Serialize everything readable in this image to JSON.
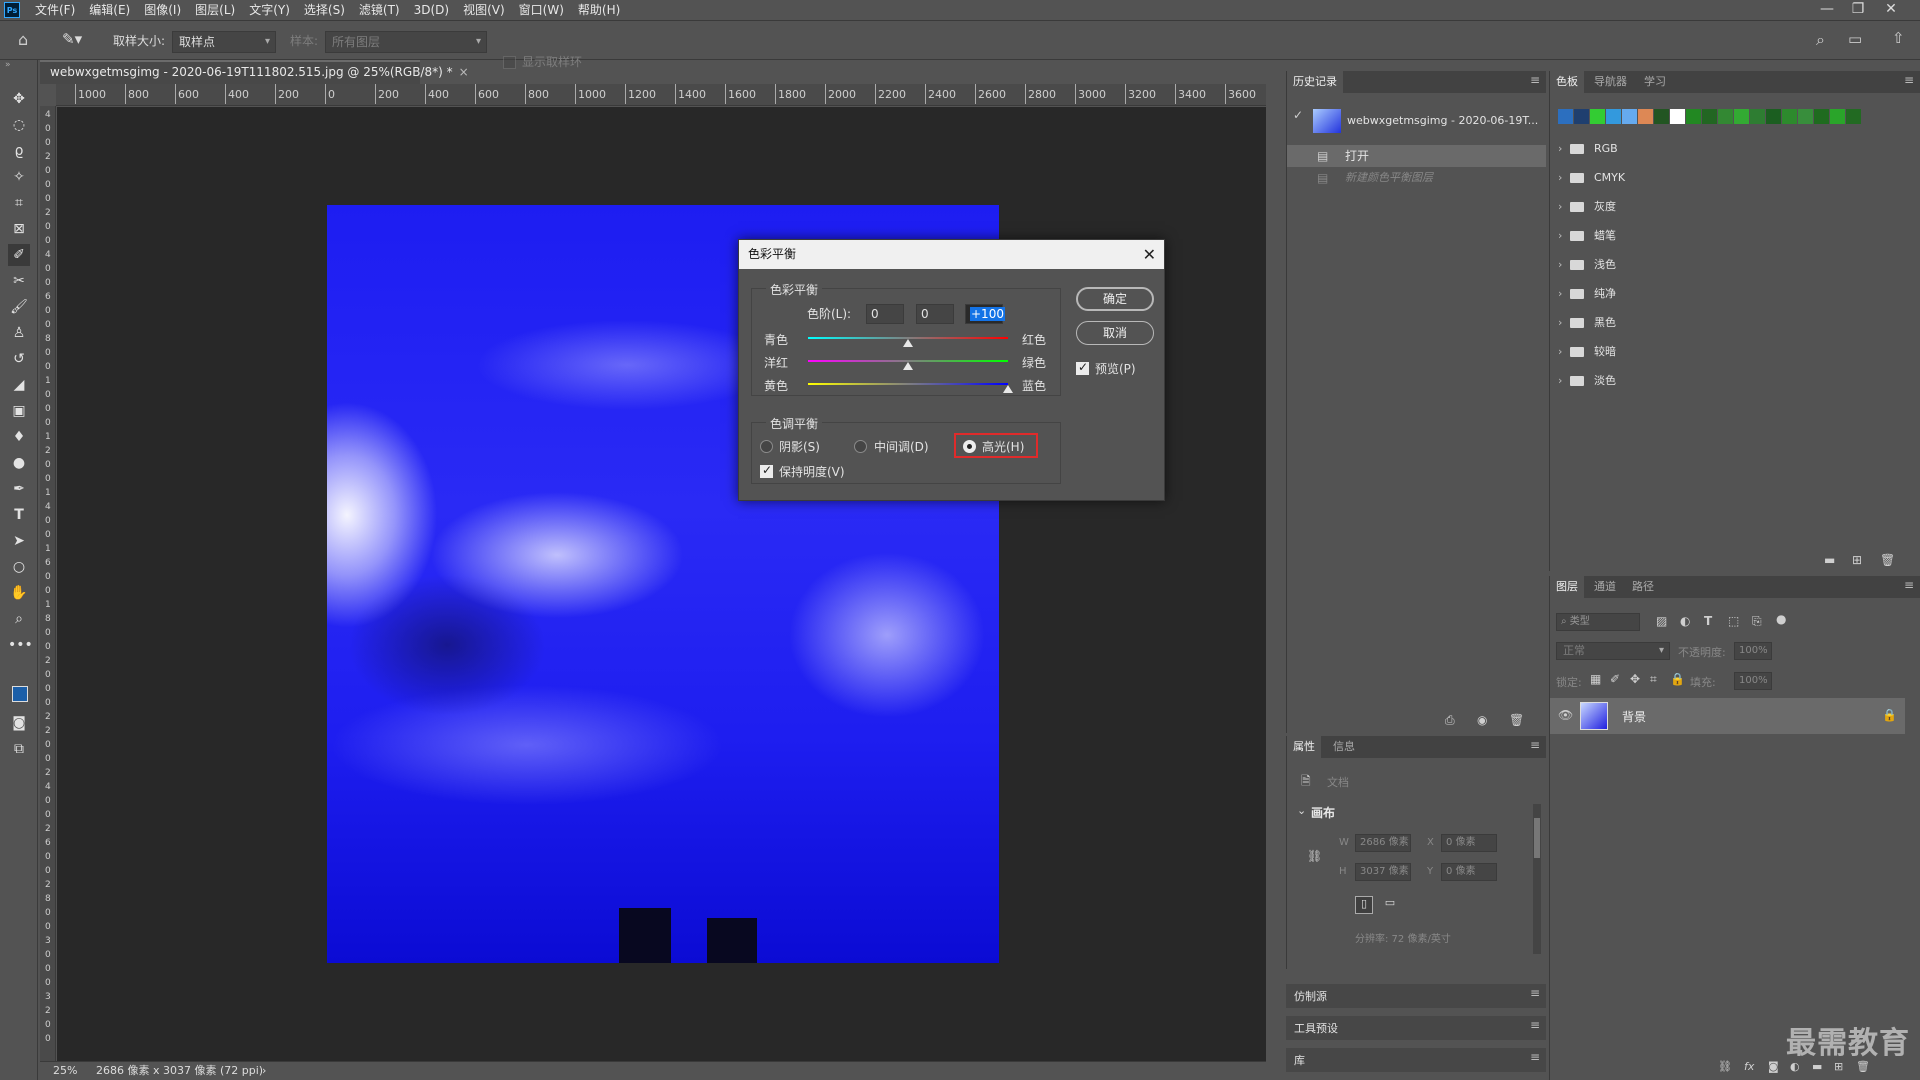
{
  "menu": {
    "logo": "Ps",
    "items": [
      "文件(F)",
      "编辑(E)",
      "图像(I)",
      "图层(L)",
      "文字(Y)",
      "选择(S)",
      "滤镜(T)",
      "3D(D)",
      "视图(V)",
      "窗口(W)",
      "帮助(H)"
    ],
    "window_buttons": [
      "—",
      "❐",
      "✕"
    ]
  },
  "options": {
    "sample_size_label": "取样大小:",
    "sample_size_value": "取样点",
    "sample_label": "样本:",
    "sample_value": "所有图层",
    "show_ring_label": "显示取样环"
  },
  "document": {
    "tab_title": "webwxgetmsgimg - 2020-06-19T111802.515.jpg @ 25%(RGB/8*) *",
    "tab_close": "×",
    "ruler_h": [
      "1000",
      "800",
      "600",
      "400",
      "200",
      "0",
      "200",
      "400",
      "600",
      "800",
      "1000",
      "1200",
      "1400",
      "1600",
      "1800",
      "2000",
      "2200",
      "2400",
      "2600",
      "2800",
      "3000",
      "3200",
      "3400",
      "3600"
    ],
    "ruler_v": [
      "4",
      "0",
      "0",
      "2",
      "0",
      "0",
      "0",
      "2",
      "0",
      "0",
      "4",
      "0",
      "0",
      "6",
      "0",
      "0",
      "8",
      "0",
      "0",
      "1",
      "0",
      "0",
      "0",
      "1",
      "2",
      "0",
      "0",
      "1",
      "4",
      "0",
      "0",
      "1",
      "6",
      "0",
      "0",
      "1",
      "8",
      "0",
      "0",
      "2",
      "0",
      "0",
      "0",
      "2",
      "2",
      "0",
      "0",
      "2",
      "4",
      "0",
      "0",
      "2",
      "6",
      "0",
      "0",
      "2",
      "8",
      "0",
      "0",
      "3",
      "0",
      "0",
      "0",
      "3",
      "2",
      "0",
      "0"
    ]
  },
  "status": {
    "zoom": "25%",
    "doc_info": "2686 像素 x 3037 像素 (72 ppi)",
    "arrow": "›"
  },
  "dialog": {
    "title": "色彩平衡",
    "close": "✕",
    "color_balance_group": "色彩平衡",
    "levels_label": "色阶(L):",
    "levels": [
      "0",
      "0",
      "+100"
    ],
    "sliders": [
      {
        "left": "青色",
        "right": "红色",
        "value": 0
      },
      {
        "left": "洋红",
        "right": "绿色",
        "value": 0
      },
      {
        "left": "黄色",
        "right": "蓝色",
        "value": 100
      }
    ],
    "tone_group": "色调平衡",
    "tones": [
      "阴影(S)",
      "中间调(D)",
      "高光(H)"
    ],
    "selected_tone": "高光(H)",
    "preserve_luminosity": "保持明度(V)",
    "ok": "确定",
    "cancel": "取消",
    "preview": "预览(P)"
  },
  "history": {
    "tabs": [
      "历史记录"
    ],
    "snapshot": "webwxgetmsgimg - 2020-06-19T...",
    "items": [
      "打开",
      "新建颜色平衡图层"
    ]
  },
  "swatches": {
    "tabs": [
      "色板",
      "导航器",
      "学习"
    ],
    "recent_colors": [
      "#2c6fbf",
      "#1f3f6f",
      "#33cc33",
      "#3399dd",
      "#66aaee",
      "#dd8855",
      "#225522",
      "#ffffff",
      "#228822",
      "#226622",
      "#338833",
      "#33aa33",
      "#2e7d32",
      "#1b5e20",
      "#2d8a2d",
      "#388e3c",
      "#1f6b1f",
      "#2aa52a",
      "#226a22"
    ],
    "groups": [
      "RGB",
      "CMYK",
      "灰度",
      "蜡笔",
      "浅色",
      "纯净",
      "黑色",
      "较暗",
      "淡色"
    ]
  },
  "layers": {
    "tabs": [
      "图层",
      "通道",
      "路径"
    ],
    "filter_placeholder": "类型",
    "blend_mode": "正常",
    "opacity_label": "不透明度:",
    "opacity_value": "100%",
    "lock_label": "锁定:",
    "fill_label": "填充:",
    "fill_value": "100%",
    "layer_name": "背景"
  },
  "properties": {
    "tabs": [
      "属性",
      "信息"
    ],
    "doc_label": "文档",
    "section": "画布",
    "w_label": "W",
    "w_value": "2686 像素",
    "h_label": "H",
    "h_value": "3037 像素",
    "x_label": "X",
    "x_value": "0 像素",
    "y_label": "Y",
    "y_value": "0 像素",
    "resolution": "分辨率: 72 像素/英寸"
  },
  "collapsed_panels": [
    "仿制源",
    "工具预设",
    "库"
  ],
  "watermark": "最需教育",
  "colors": {
    "accent": "#1473e6",
    "highlight_box": "#e02b2b"
  }
}
